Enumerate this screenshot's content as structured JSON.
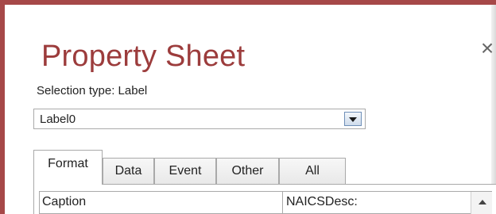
{
  "panel": {
    "title": "Property Sheet",
    "close_glyph": "×",
    "selection_type_text": "Selection type:  Label"
  },
  "object_selector": {
    "value": "Label0"
  },
  "tabs": [
    {
      "label": "Format",
      "active": true
    },
    {
      "label": "Data",
      "active": false
    },
    {
      "label": "Event",
      "active": false
    },
    {
      "label": "Other",
      "active": false
    },
    {
      "label": "All",
      "active": false
    }
  ],
  "properties": [
    {
      "name": "Caption",
      "value": "NAICSDesc:"
    }
  ],
  "colors": {
    "accent": "#9c3c3c",
    "frame_border": "#a64848"
  },
  "icons": {
    "close": "close-icon",
    "dropdown": "chevron-down-icon",
    "scroll_up": "scroll-up-icon"
  }
}
